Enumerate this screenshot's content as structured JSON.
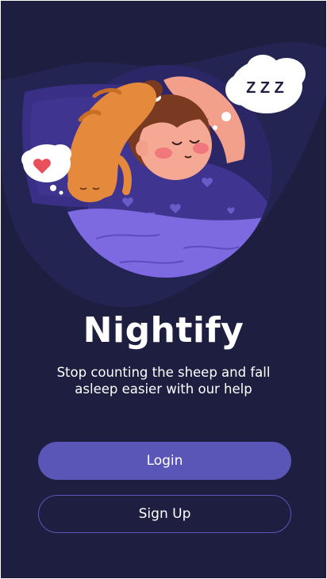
{
  "app": {
    "name": "Nightify"
  },
  "onboarding": {
    "tagline": "Stop counting the sheep and fall asleep easier with our help",
    "dream_bubble_text": "Z Z Z"
  },
  "actions": {
    "login_label": "Login",
    "signup_label": "Sign Up"
  },
  "colors": {
    "background": "#1e1f40",
    "accent": "#5a56b8",
    "blanket": "#7d69e0",
    "text": "#ffffff"
  },
  "icons": [
    "sleeping-girl-illustration",
    "cat-icon",
    "heart-icon",
    "thought-bubble-icon"
  ]
}
